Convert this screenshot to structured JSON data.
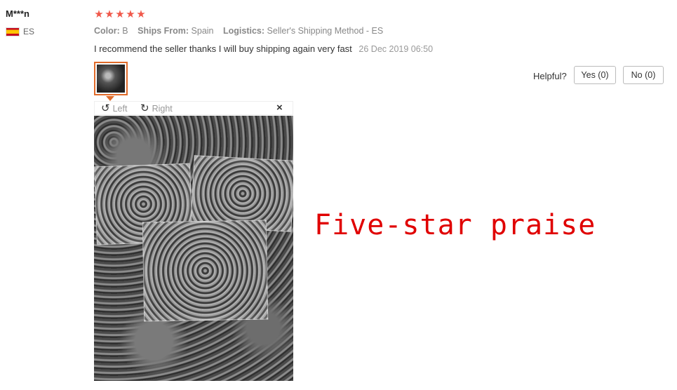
{
  "reviewer": {
    "name": "M***n",
    "country_code": "ES",
    "flag_icon": "spain-flag-icon"
  },
  "rating": {
    "stars": 5,
    "max": 5,
    "glyph": "★",
    "color": "#f0584a"
  },
  "meta": {
    "color_label": "Color:",
    "color_value": "B",
    "ships_label": "Ships From:",
    "ships_value": "Spain",
    "logistics_label": "Logistics:",
    "logistics_value": "Seller's Shipping Method - ES"
  },
  "review": {
    "text": "I recommend the seller thanks I will buy shipping again very fast",
    "date": "26 Dec 2019 06:50"
  },
  "helpful": {
    "label": "Helpful?",
    "yes": "Yes (0)",
    "no": "No (0)"
  },
  "viewer": {
    "rotate_left_label": "Left",
    "rotate_right_label": "Right",
    "close_glyph": "×",
    "rotate_left_glyph": "↺",
    "rotate_right_glyph": "↻"
  },
  "overlay_text": "Five-star praise",
  "colors": {
    "accent": "#e06b2a",
    "overlay": "#e00000"
  }
}
